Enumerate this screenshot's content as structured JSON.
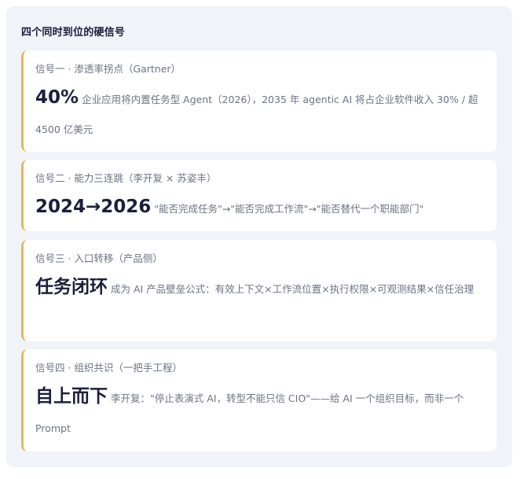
{
  "title": "四个同时到位的硬信号",
  "accent_color": "#e7b65a",
  "cards": [
    {
      "label": "信号一 · 渗透率拐点（Gartner）",
      "headline": "40%",
      "text": "企业应用将内置任务型 Agent（2026），2035 年 agentic AI 将占企业软件收入 30% / 超 4500 亿美元"
    },
    {
      "label": "信号二 · 能力三连跳（李开复 × 苏姿丰）",
      "headline": "2024→2026",
      "text": "\"能否完成任务\"→\"能否完成工作流\"→\"能否替代一个职能部门\""
    },
    {
      "label": "信号三 · 入口转移（产品侧）",
      "headline": "任务闭环",
      "text": "成为 AI 产品壁垒公式：有效上下文×工作流位置×执行权限×可观测结果×信任治理"
    },
    {
      "label": "信号四 · 组织共识（一把手工程）",
      "headline": "自上而下",
      "text": "李开复：\"停止表演式 AI，转型不能只信 CIO\"——给 AI 一个组织目标，而非一个 Prompt"
    }
  ]
}
